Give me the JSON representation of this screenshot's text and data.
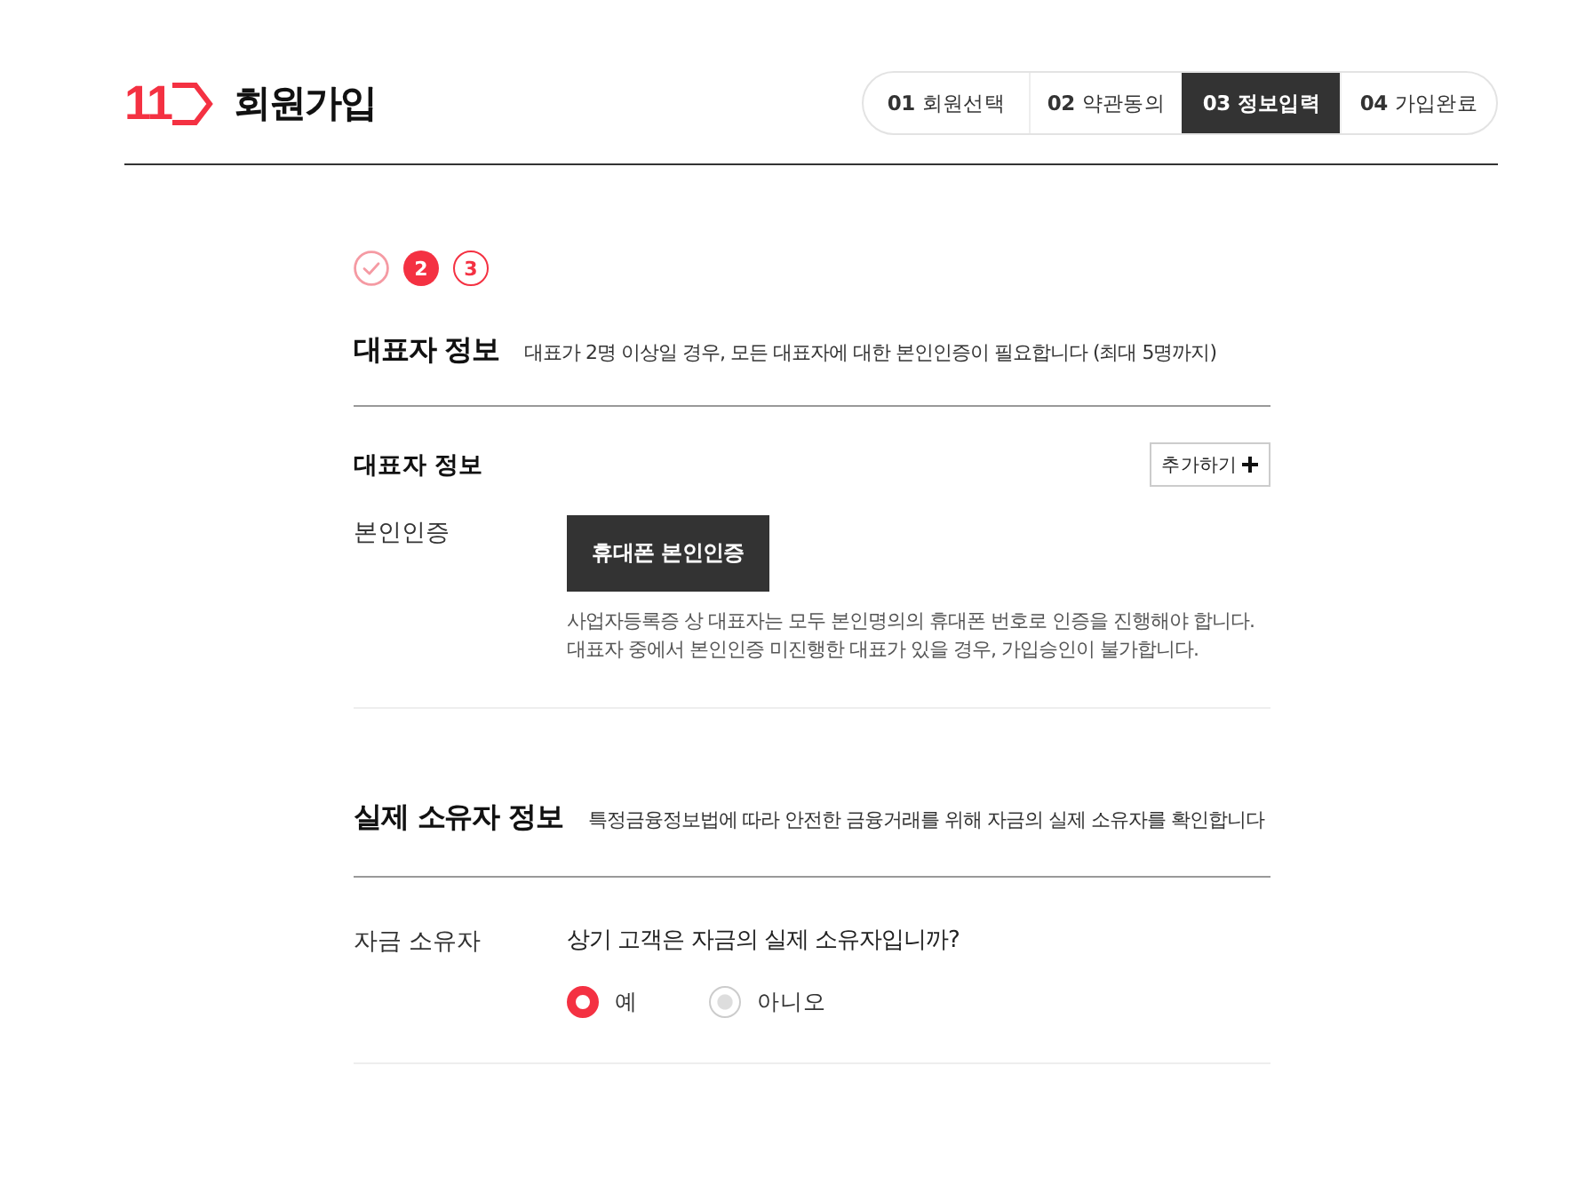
{
  "header": {
    "logo": "11",
    "title": "회원가입",
    "steps": [
      {
        "number": "01",
        "label": "회원선택",
        "selected": false
      },
      {
        "number": "02",
        "label": "약관동의",
        "selected": false
      },
      {
        "number": "03",
        "label": "정보입력",
        "selected": true
      },
      {
        "number": "04",
        "label": "가입완료",
        "selected": false
      }
    ]
  },
  "progress": [
    {
      "kind": "done"
    },
    {
      "kind": "current",
      "label": "2"
    },
    {
      "kind": "pending",
      "label": "3"
    }
  ],
  "representative_section": {
    "title": "대표자 정보",
    "description": "대표가 2명 이상일 경우, 모든 대표자에 대한 본인인증이 필요합니다 (최대 5명까지)",
    "subtitle": "대표자 정보",
    "add_button": "추가하기",
    "verification": {
      "label": "본인인증",
      "button": "휴대폰 본인인증",
      "notes": [
        "사업자등록증 상 대표자는 모두 본인명의의 휴대폰 번호로 인증을 진행해야 합니다.",
        "대표자 중에서 본인인증 미진행한 대표가 있을 경우, 가입승인이 불가합니다."
      ]
    }
  },
  "owner_section": {
    "title": "실제 소유자 정보",
    "description": "특정금융정보법에 따라 안전한 금융거래를 위해 자금의 실제 소유자를 확인합니다",
    "field": {
      "label": "자금 소유자",
      "question": "상기 고객은 자금의 실제 소유자입니까?",
      "options": [
        {
          "label": "예",
          "selected": true
        },
        {
          "label": "아니오",
          "selected": false
        }
      ]
    }
  }
}
